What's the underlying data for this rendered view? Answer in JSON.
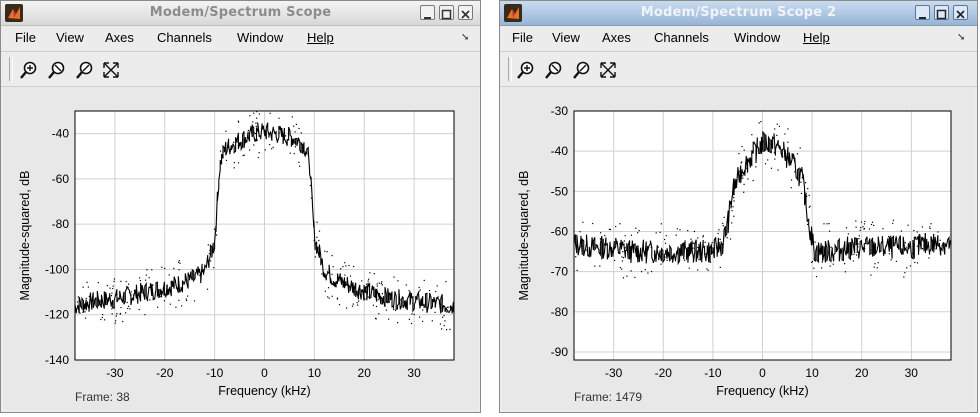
{
  "windows": [
    {
      "title": "Modem/Spectrum Scope",
      "menu": [
        "File",
        "View",
        "Axes",
        "Channels",
        "Window",
        "Help"
      ],
      "frame_label": "Frame: 38",
      "chart_data": {
        "type": "line",
        "xlabel": "Frequency (kHz)",
        "ylabel": "Magnitude-squared, dB",
        "xlim": [
          -38,
          38
        ],
        "ylim": [
          -140,
          -30
        ],
        "x_ticks": [
          -30,
          -20,
          -10,
          0,
          10,
          20,
          30
        ],
        "y_ticks": [
          -140,
          -120,
          -100,
          -80,
          -60,
          -40
        ],
        "grid": true,
        "series": [
          {
            "x": [
              -38,
              -34,
              -30,
              -26,
              -22,
              -18,
              -14,
              -12,
              -10,
              -9.5,
              -9,
              -8,
              -6,
              -4,
              -2,
              0,
              2,
              4,
              6,
              8,
              9,
              9.5,
              10,
              12,
              14,
              18,
              22,
              26,
              30,
              34,
              38
            ],
            "values": [
              -116,
              -114,
              -113,
              -111,
              -109,
              -107,
              -104,
              -101,
              -88,
              -72,
              -54,
              -47,
              -44,
              -42,
              -40,
              -39,
              -40,
              -41,
              -42,
              -45,
              -52,
              -70,
              -86,
              -100,
              -104,
              -108,
              -111,
              -113,
              -114,
              -115,
              -116
            ]
          }
        ]
      }
    },
    {
      "title": "Modem/Spectrum Scope 2",
      "menu": [
        "File",
        "View",
        "Axes",
        "Channels",
        "Window",
        "Help"
      ],
      "frame_label": "Frame: 1479",
      "chart_data": {
        "type": "line",
        "xlabel": "Frequency (kHz)",
        "ylabel": "Magnitude-squared, dB",
        "xlim": [
          -38,
          38
        ],
        "ylim": [
          -92,
          -30
        ],
        "x_ticks": [
          -30,
          -20,
          -10,
          0,
          10,
          20,
          30
        ],
        "y_ticks": [
          -90,
          -80,
          -70,
          -60,
          -50,
          -40,
          -30
        ],
        "grid": true,
        "series": [
          {
            "x": [
              -38,
              -34,
              -30,
              -26,
              -22,
              -18,
              -14,
              -10,
              -8,
              -7,
              -6,
              -4,
              -2,
              0,
              2,
              4,
              6,
              8,
              9,
              10,
              10.5,
              12,
              14,
              18,
              22,
              26,
              30,
              34,
              38
            ],
            "values": [
              -63,
              -64,
              -64,
              -65,
              -65,
              -65,
              -65,
              -65,
              -63,
              -58,
              -50,
              -44,
              -41,
              -38,
              -38,
              -40,
              -43,
              -47,
              -55,
              -62,
              -65,
              -65,
              -65,
              -64,
              -64,
              -64,
              -64,
              -63,
              -63
            ]
          }
        ]
      }
    }
  ]
}
